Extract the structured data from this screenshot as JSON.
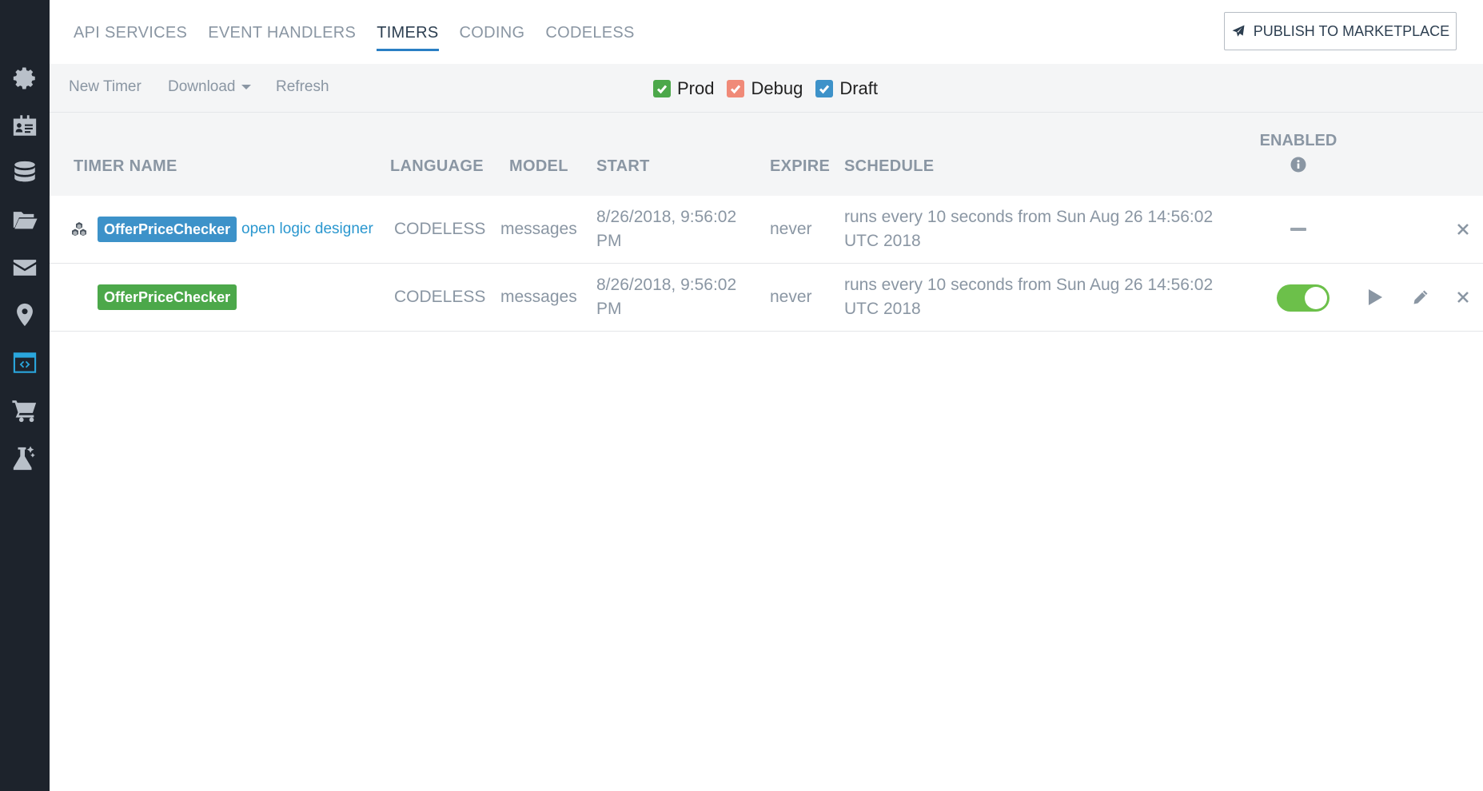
{
  "sidebar": {
    "items": [
      {
        "icon": "gear-icon"
      },
      {
        "icon": "id-card-icon"
      },
      {
        "icon": "database-icon"
      },
      {
        "icon": "folder-icon"
      },
      {
        "icon": "envelope-icon"
      },
      {
        "icon": "map-pin-icon"
      },
      {
        "icon": "code-window-icon",
        "active": true
      },
      {
        "icon": "cart-icon"
      },
      {
        "icon": "flask-icon"
      }
    ],
    "active_color": "#2aa6dd"
  },
  "tabs": [
    {
      "label": "API SERVICES"
    },
    {
      "label": "EVENT HANDLERS"
    },
    {
      "label": "TIMERS",
      "active": true
    },
    {
      "label": "CODING"
    },
    {
      "label": "CODELESS"
    }
  ],
  "publish": {
    "label": "PUBLISH TO MARKETPLACE",
    "icon": "paper-plane-icon"
  },
  "toolbar": {
    "new_timer": "New Timer",
    "download": "Download",
    "refresh": "Refresh"
  },
  "filters": [
    {
      "label": "Prod",
      "checked": true,
      "color": "#4ca84a"
    },
    {
      "label": "Debug",
      "checked": true,
      "color": "#f08a78"
    },
    {
      "label": "Draft",
      "checked": true,
      "color": "#3d92c9"
    }
  ],
  "table": {
    "headers": {
      "timer_name": "TIMER NAME",
      "language": "LANGUAGE",
      "model": "MODEL",
      "start": "START",
      "expire": "EXPIRE",
      "schedule": "SCHEDULE",
      "enabled": "ENABLED"
    },
    "rows": [
      {
        "name": "OfferPriceChecker",
        "name_color": "#3d92c9",
        "link": "open logic designer",
        "language": "CODELESS",
        "model": "messages",
        "start_line1": "8/26/2018, 9:56:02",
        "start_line2": "PM",
        "expire": "never",
        "schedule_line1": "runs every 10 seconds from Sun Aug 26 14:56:02",
        "schedule_line2": "UTC 2018",
        "enabled": "indeterminate"
      },
      {
        "name": "OfferPriceChecker",
        "name_color": "#4ca84a",
        "language": "CODELESS",
        "model": "messages",
        "start_line1": "8/26/2018, 9:56:02",
        "start_line2": "PM",
        "expire": "never",
        "schedule_line1": "runs every 10 seconds from Sun Aug 26 14:56:02",
        "schedule_line2": "UTC 2018",
        "enabled": true
      }
    ]
  }
}
